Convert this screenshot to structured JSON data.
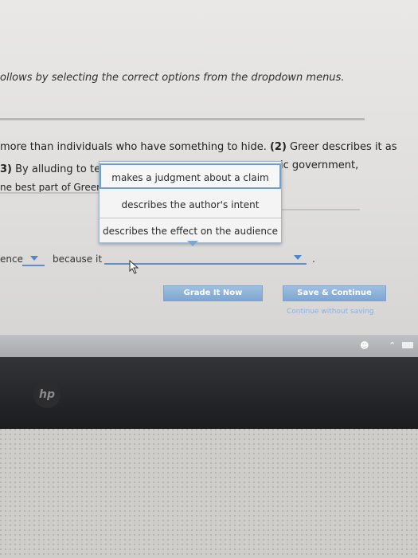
{
  "instruction": "ollows by selecting the correct options from the dropdown menus.",
  "passage": {
    "line1_pre": "more than individuals who have something to hide. ",
    "line1_num": "(2)",
    "line1_post": " Greer describes it as",
    "line2_num": "3)",
    "line2_text": " By alluding to tens",
    "line2_right": "ic government,",
    "line3_text": "ne best part of Greer'"
  },
  "dropdown": {
    "options": [
      "makes a judgment about a claim",
      "describes the author's intent",
      "describes the effect on the audience"
    ]
  },
  "row4": {
    "left_text": "ence",
    "because": "because it",
    "period": "."
  },
  "buttons": {
    "grade": "Grade It Now",
    "save": "Save & Continue",
    "continue_link": "Continue without saving"
  },
  "logo": "hp"
}
